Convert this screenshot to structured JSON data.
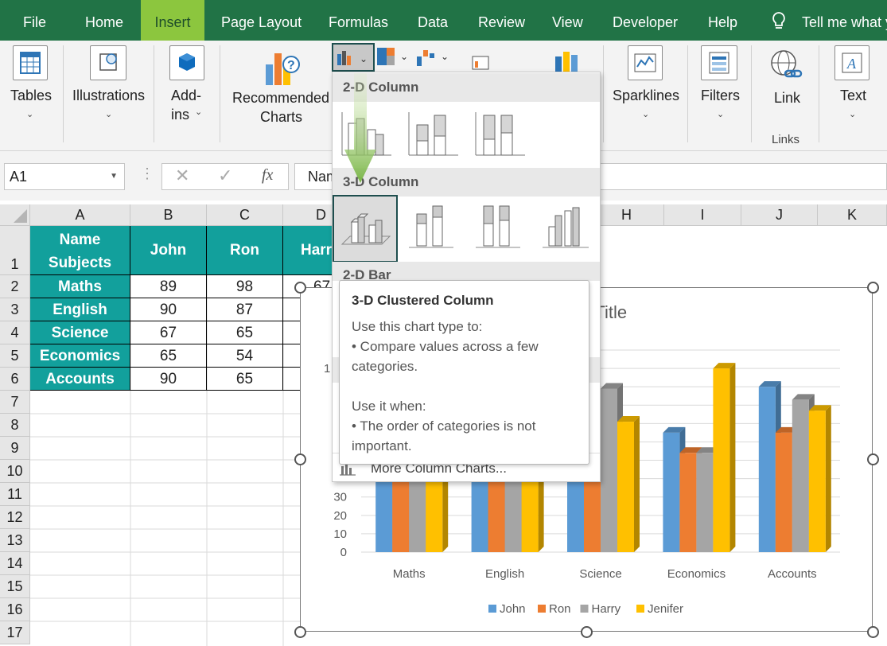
{
  "ribbon_tabs": [
    "File",
    "Home",
    "Insert",
    "Page Layout",
    "Formulas",
    "Data",
    "Review",
    "View",
    "Developer",
    "Help"
  ],
  "active_tab": "Insert",
  "tell_me": "Tell me what y",
  "ribbon": {
    "tables": "Tables",
    "illustrations": "Illustrations",
    "addins_1": "Add-",
    "addins_2": "ins",
    "recommended_1": "Recommended",
    "recommended_2": "Charts",
    "sparklines": "Sparklines",
    "filters": "Filters",
    "link": "Link",
    "links_group": "Links",
    "text": "Text"
  },
  "formula_bar": {
    "name_box": "A1",
    "fx": "fx",
    "content": "Nam"
  },
  "columns": [
    "A",
    "B",
    "C",
    "D",
    "H",
    "I",
    "J",
    "K"
  ],
  "rows": [
    "1",
    "2",
    "3",
    "4",
    "5",
    "6",
    "7",
    "8",
    "9",
    "10",
    "11",
    "12",
    "13",
    "14",
    "15",
    "16",
    "17"
  ],
  "table": {
    "header_line1": "Name",
    "header_line2": "Subjects",
    "col_headers": [
      "John",
      "Ron",
      "Harr"
    ],
    "rows": [
      {
        "subject": "Maths",
        "john": "89",
        "ron": "98",
        "harry": "67"
      },
      {
        "subject": "English",
        "john": "90",
        "ron": "87",
        "harry": ""
      },
      {
        "subject": "Science",
        "john": "67",
        "ron": "65",
        "harry": ""
      },
      {
        "subject": "Economics",
        "john": "65",
        "ron": "54",
        "harry": ""
      },
      {
        "subject": "Accounts",
        "john": "90",
        "ron": "65",
        "harry": ""
      }
    ]
  },
  "dropdown": {
    "section_2d_column": "2-D Column",
    "section_3d_column": "3-D Column",
    "section_2d_bar": "2-D Bar",
    "more": "More Column Charts..."
  },
  "tooltip": {
    "title": "3-D Clustered Column",
    "line1": "Use this chart type to:",
    "line2": "• Compare values across a few categories.",
    "line3": "Use it when:",
    "line4": "• The order of categories is not important."
  },
  "chart_data": {
    "type": "bar",
    "title": "Chart Title",
    "categories": [
      "Maths",
      "English",
      "Science",
      "Economics",
      "Accounts"
    ],
    "series": [
      {
        "name": "John",
        "values": [
          89,
          90,
          67,
          65,
          90
        ],
        "color": "#5b9bd5"
      },
      {
        "name": "Ron",
        "values": [
          98,
          87,
          65,
          54,
          65
        ],
        "color": "#ed7d31"
      },
      {
        "name": "Harry",
        "values": [
          67,
          90,
          89,
          54,
          83
        ],
        "color": "#a5a5a5"
      },
      {
        "name": "Jenifer",
        "values": [
          55,
          71,
          71,
          100,
          77
        ],
        "color": "#ffc000"
      }
    ],
    "ylim": [
      0,
      110
    ],
    "visible_ticks": [
      "0",
      "10",
      "20",
      "30",
      "1"
    ],
    "legend_position": "bottom"
  }
}
